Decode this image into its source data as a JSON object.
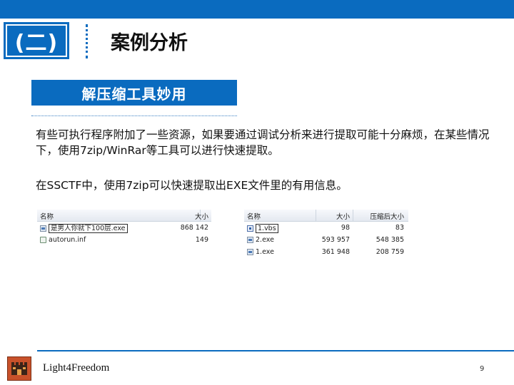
{
  "header": {
    "section_label": "(二)",
    "title": "案例分析"
  },
  "subsection": {
    "title": "解压缩工具妙用"
  },
  "body": {
    "paragraph1": "有些可执行程序附加了一些资源，如果要通过调试分析来进行提取可能十分麻烦，在某些情况下，使用7zip/WinRar等工具可以进行快速提取。",
    "paragraph2": "在SSCTF中，使用7zip可以快速提取出EXE文件里的有用信息。"
  },
  "explorer_left": {
    "columns": [
      "名称",
      "大小"
    ],
    "rows": [
      {
        "name": "是男人你就下100层.exe",
        "size": "868 142",
        "icon": "exe-file-icon",
        "selected": true
      },
      {
        "name": "autorun.inf",
        "size": "149",
        "icon": "inf-file-icon",
        "selected": false
      }
    ]
  },
  "explorer_right": {
    "columns": [
      "名称",
      "大小",
      "压缩后大小"
    ],
    "rows": [
      {
        "name": "1.vbs",
        "size": "98",
        "packed": "83",
        "icon": "vbs-file-icon",
        "selected": true
      },
      {
        "name": "2.exe",
        "size": "593 957",
        "packed": "548 385",
        "icon": "exe-file-icon",
        "selected": false
      },
      {
        "name": "1.exe",
        "size": "361 948",
        "packed": "208 759",
        "icon": "exe-file-icon",
        "selected": false
      }
    ]
  },
  "footer": {
    "brand": "Light4Freedom",
    "page_number": "9"
  },
  "colors": {
    "accent": "#0a6bbf",
    "logo": "#c8512a"
  }
}
